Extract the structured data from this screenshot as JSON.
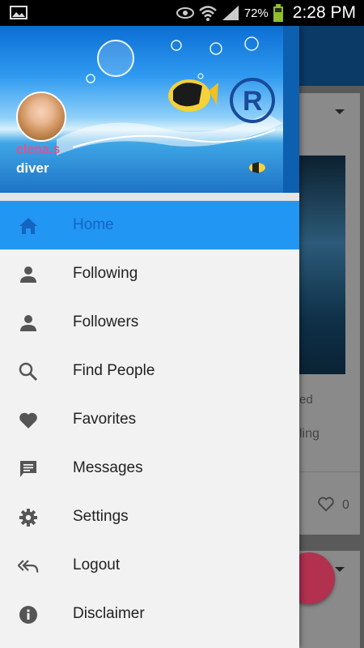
{
  "status_bar": {
    "battery": "72%",
    "time": "2:28 PM"
  },
  "drawer": {
    "user": {
      "name": "elena.s",
      "role": "diver"
    },
    "items": [
      {
        "label": "Home",
        "icon": "home-icon",
        "active": true
      },
      {
        "label": "Following",
        "icon": "person-icon"
      },
      {
        "label": "Followers",
        "icon": "person-icon"
      },
      {
        "label": "Find People",
        "icon": "search-icon"
      },
      {
        "label": "Favorites",
        "icon": "heart-icon"
      },
      {
        "label": "Messages",
        "icon": "message-icon"
      },
      {
        "label": "Settings",
        "icon": "gear-icon"
      },
      {
        "label": "Logout",
        "icon": "reply-all-icon"
      },
      {
        "label": "Disclaimer",
        "icon": "info-icon"
      }
    ]
  },
  "background": {
    "card_text_1": "ed",
    "card_text_2": "ling",
    "like_count": "0"
  },
  "colors": {
    "accent": "#2196f3",
    "username": "#e94e8c",
    "fab": "#b1314f"
  }
}
